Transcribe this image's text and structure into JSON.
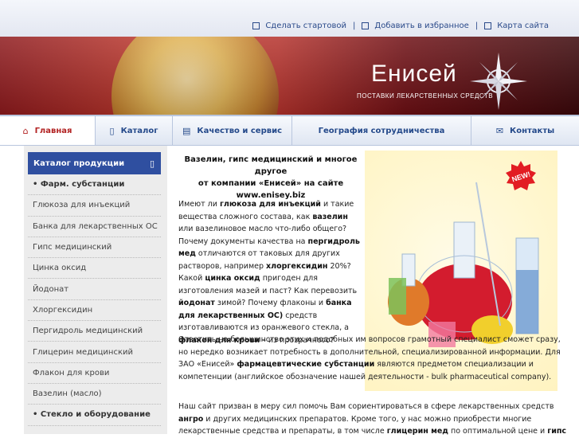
{
  "toplinks": {
    "home_label": "Сделать стартовой",
    "fav_label": "Добавить в избранное",
    "map_label": "Карта сайта",
    "sep": "|"
  },
  "banner": {
    "brand": "Енисей",
    "tagline": "ПОСТАВКИ ЛЕКАРСТВЕННЫХ СРЕДСТВ"
  },
  "nav": {
    "items": [
      {
        "label": "Главная",
        "icon": "home-icon"
      },
      {
        "label": "Каталог",
        "icon": "book-icon"
      },
      {
        "label": "Качество и сервис",
        "icon": "document-icon"
      },
      {
        "label": "География сотрудничества",
        "icon": ""
      },
      {
        "label": "Контакты",
        "icon": "mail-icon"
      }
    ]
  },
  "sidebar": {
    "title": "Каталог продукции",
    "items": [
      {
        "label": "• Фарм. субстанции",
        "bold": true
      },
      {
        "label": "Глюкоза для инъекций",
        "bold": false
      },
      {
        "label": "Банка для лекарственных ОС",
        "bold": false
      },
      {
        "label": "Гипс медицинский",
        "bold": false
      },
      {
        "label": "Цинка оксид",
        "bold": false
      },
      {
        "label": "Йодонат",
        "bold": false
      },
      {
        "label": "Хлоргексидин",
        "bold": false
      },
      {
        "label": "Пергидроль медицинский",
        "bold": false
      },
      {
        "label": "Глицерин медицинский",
        "bold": false
      },
      {
        "label": "Флакон для крови",
        "bold": false
      },
      {
        "label": "Вазелин (масло)",
        "bold": false
      },
      {
        "label": "• Стекло и оборудование",
        "bold": true
      }
    ]
  },
  "main": {
    "badge": "NEW!",
    "intro_1": "Вазелин, гипс медицинский и многое другое",
    "intro_2": "от компании «Енисей» на сайте",
    "intro_3": "www.enisey.biz",
    "p1": {
      "a": "Имеют ли ",
      "b1": "глюкоза для инъекций",
      "c": " и такие вещества сложного состава, как ",
      "b2": "вазелин",
      "d": " или вазелиновое масло что-либо общего? Почему документы качества на ",
      "b3": "пергидроль мед",
      "e": " отличаются от таковых для других растворов, например ",
      "b4": "хлоргексидин",
      "f": " 20%? Какой ",
      "b5": "цинка оксид",
      "g": " пригоден для изготовления мазей и паст? Как перевозить ",
      "b6": "йодонат",
      "h": " зимой? Почему флаконы и ",
      "b7": "банка для лекарственных ОС)",
      "i": " средств изготавливаются из оранжевого стекла, а ",
      "b8": "флакон для крови",
      "j": " – из прозрачного?"
    },
    "p2": {
      "a": "Ответить на большинство этих и подобных им вопросов грамотный специалист сможет сразу, но нередко возникает потребность в дополнительной, специализированной информации. Для ЗАО «Енисей» ",
      "b1": "фармацевтические субстанции",
      "c": " являются предметом специализации и компетенции (английское обозначение нашей деятельности - bulk pharmaceutical company)."
    },
    "p3": {
      "a": "Наш сайт призван в меру сил помочь Вам сориентироваться в сфере лекарственных средств ",
      "b1": "ангро",
      "c": " и других медицинских препаратов. Кроме того, у нас можно приобрести многие лекарственные средства и препараты, в том числе ",
      "b2": "глицерин мед",
      "d": " по оптимальной цене и ",
      "b3": "гипс"
    }
  },
  "colors": {
    "accent": "#2f4fa0",
    "nav_text": "#24498a",
    "active": "#b22222",
    "banner": "#b5322c"
  }
}
